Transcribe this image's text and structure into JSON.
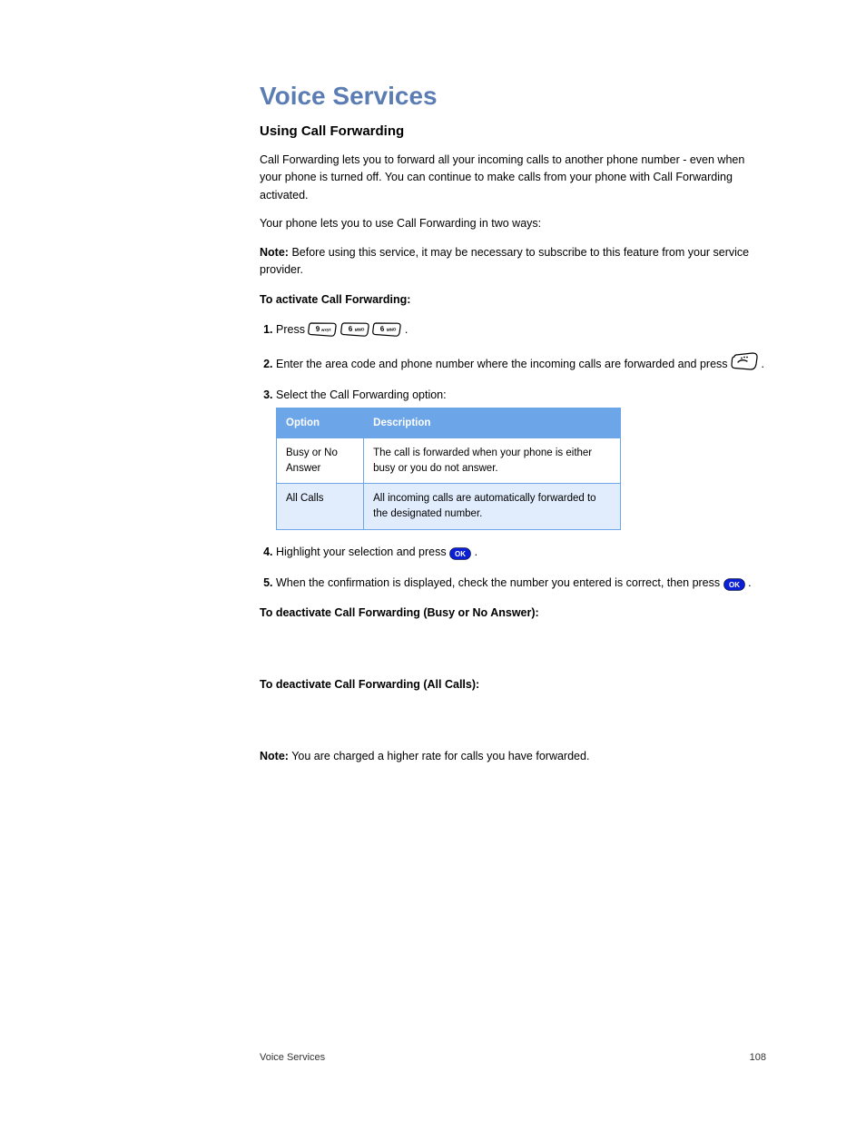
{
  "headings": {
    "h1": "Voice Services",
    "h2": "Using Call Forwarding"
  },
  "paragraphs": {
    "intro": "Call Forwarding lets you to forward all your incoming calls to another phone number - even when your phone is turned off. You can continue to make calls from your phone with Call Forwarding activated.",
    "afterSteps": "Your phone lets you to use Call Forwarding in two ways:",
    "to_activate": "To activate Call Forwarding:",
    "to_deactivate_busy": "To deactivate Call Forwarding (Busy or No Answer):",
    "to_deactivate_all": "To deactivate Call Forwarding (All Calls):",
    "charge_note": "You are charged a higher rate for calls you have forwarded."
  },
  "note": {
    "label": "Note:",
    "text": "Before using this service, it may be necessary to subscribe to this feature from your service provider."
  },
  "steps_activate": [
    {
      "prefix": "Press ",
      "after_keys": "."
    },
    {
      "prefix": "Enter the area code and phone number where the incoming calls are forwarded and press ",
      "after_talk": "."
    },
    {
      "prefix": "Select the Call Forwarding option:"
    },
    {
      "prefix": "Highlight your selection and press ",
      "after_ok1": "."
    },
    {
      "prefix": "When the confirmation is displayed, check the number you entered is correct, then press ",
      "after_ok2": "."
    }
  ],
  "table": {
    "headers": [
      "Option",
      "Description"
    ],
    "rows": [
      [
        "Busy or No Answer",
        "The call is forwarded when your phone is either busy or you do not answer."
      ],
      [
        "All Calls",
        "All incoming calls are automatically forwarded to the designated number."
      ]
    ]
  },
  "footer": {
    "left": "Voice Services",
    "right": "108"
  },
  "keys": {
    "k1": {
      "digit": "9",
      "label": "wxyz"
    },
    "k2": {
      "digit": "6",
      "label": "MNO"
    },
    "k3": {
      "digit": "6",
      "label": "MNO"
    }
  },
  "ok_label": "OK"
}
